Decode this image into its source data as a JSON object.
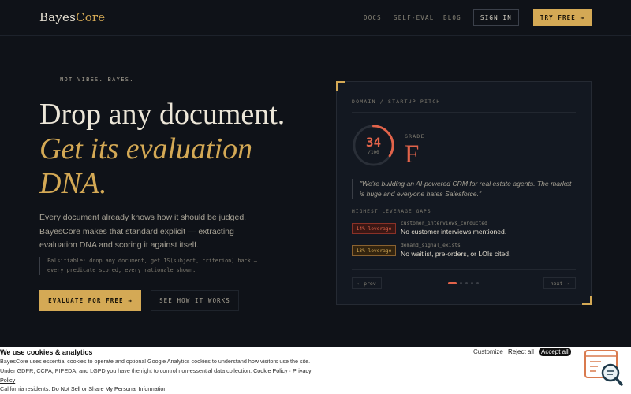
{
  "nav": {
    "logo_main": "Bayes",
    "logo_accent": "Core",
    "links": [
      "DOCS",
      "SELF-EVAL",
      "BLOG"
    ],
    "signin": "SIGN IN",
    "try_free": "TRY FREE →"
  },
  "hero": {
    "eyebrow": "NOT VIBES. BAYES.",
    "headline": "Drop any document.",
    "headline_italic": "Get its evaluation DNA.",
    "lede": "Every document already knows how it should be judged. BayesCore makes that standard explicit — extracting evaluation DNA and scoring it against itself.",
    "falsifiable": "Falsifiable: drop any document, get IS(subject, criterion) back — every predicate scored, every rationale shown.",
    "cta_primary": "EVALUATE FOR FREE →",
    "cta_secondary": "SEE HOW IT WORKS"
  },
  "card": {
    "domain": "DOMAIN / STARTUP-PITCH",
    "score": "34",
    "score_max": "/100",
    "score_fraction": 0.34,
    "grade_label": "GRADE",
    "grade": "F",
    "quote": "\"We're building an AI-powered CRM for real estate agents. The market is huge and everyone hates Salesforce.\"",
    "gaps_title": "HIGHEST_LEVERAGE_GAPS",
    "gaps": [
      {
        "badge": "14% leverage",
        "key": "customer_interviews_conducted",
        "desc": "No customer interviews mentioned."
      },
      {
        "badge": "13% leverage",
        "key": "demand_signal_exists",
        "desc": "No waitlist, pre-orders, or LOIs cited."
      }
    ],
    "prev": "← prev",
    "next": "next →"
  },
  "cookie": {
    "title": "We use cookies & analytics",
    "body": "BayesCore uses essential cookies to operate and optional Google Analytics cookies to understand how visitors use the site. Under GDPR, CCPA, PIPEDA, and LGPD you have the right to control non-essential data collection.",
    "cookie_policy": "Cookie Policy",
    "sep": " · ",
    "privacy_policy": "Privacy Policy",
    "ca_prefix": "California residents: ",
    "ca_link": "Do Not Sell or Share My Personal Information",
    "customize": "Customize",
    "reject": "Reject all",
    "accept": "Accept all"
  },
  "colors": {
    "accent": "#d4a955",
    "danger": "#e2634a",
    "background": "#0f1218"
  }
}
